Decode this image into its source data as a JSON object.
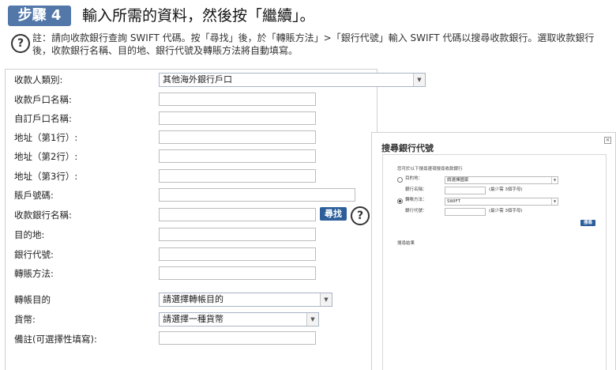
{
  "header": {
    "step_label": "步驟 4",
    "title": "輸入所需的資料，然後按「繼續」。"
  },
  "note": {
    "help_symbol": "?",
    "text": "註：請向收款銀行查詢 SWIFT 代碼。按「尋找」後，於「轉賬方法」>「銀行代號」輸入 SWIFT 代碼以搜尋收款銀行。選取收款銀行後，收款銀行名稱、目的地、銀行代號及轉賬方法將自動填寫。"
  },
  "form": {
    "payee_type_label": "收款人類別:",
    "payee_type_value": "其他海外銀行戶口",
    "account_name_label": "收款戶口名稱:",
    "custom_name_label": "自訂戶口名稱:",
    "address1_label": "地址（第1行）:",
    "address2_label": "地址（第2行）:",
    "address3_label": "地址（第3行）:",
    "account_no_label": "賬戶號碼:",
    "bank_name_label": "收款銀行名稱:",
    "search_button": "尋找",
    "destination_label": "目的地:",
    "bank_code_label": "銀行代號:",
    "transfer_method_label": "轉賬方法:",
    "purpose_label": "轉帳目的",
    "purpose_value": "請選擇轉帳目的",
    "currency_label": "貨幣:",
    "currency_value": "請選擇一種貨幣",
    "remarks_label": "備註(可選擇性填寫):"
  },
  "popup": {
    "title": "搜尋銀行代號",
    "close_symbol": "×",
    "instruction": "您可於以下搜尋選項搜尋收款銀行",
    "option1_label": "目的地：",
    "option1_select": "請選擇國家",
    "bank_name_label": "銀行名稱：",
    "bank_name_hint": "(最少需 3個字母)",
    "option2_label": "轉賬方法：",
    "option2_select": "SWIFT",
    "bank_code_label": "銀行代號：",
    "bank_code_hint": "(最少需 3個字母)",
    "search_button": "搜尋",
    "results_label": "搜尋結果"
  }
}
